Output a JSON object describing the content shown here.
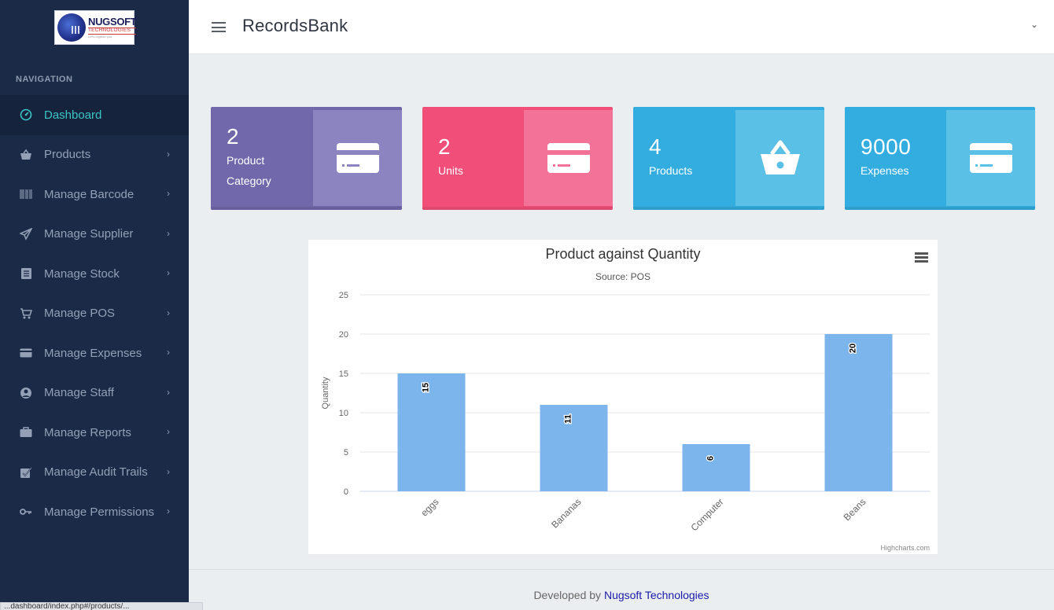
{
  "logo": {
    "line1": "NUGSOFT",
    "line2": "TECHNOLOGIES",
    "line3": "Let's Digitize you"
  },
  "nav": {
    "heading": "NAVIGATION",
    "items": [
      {
        "label": "Dashboard",
        "icon": "dashboard-icon",
        "active": true
      },
      {
        "label": "Products",
        "icon": "basket-icon"
      },
      {
        "label": "Manage Barcode",
        "icon": "barcode-icon"
      },
      {
        "label": "Manage Supplier",
        "icon": "paper-plane-icon"
      },
      {
        "label": "Manage Stock",
        "icon": "list-icon"
      },
      {
        "label": "Manage POS",
        "icon": "cart-icon"
      },
      {
        "label": "Manage Expenses",
        "icon": "credit-card-icon"
      },
      {
        "label": "Manage Staff",
        "icon": "user-circle-icon"
      },
      {
        "label": "Manage Reports",
        "icon": "briefcase-icon"
      },
      {
        "label": "Manage Audit Trails",
        "icon": "check-square-icon"
      },
      {
        "label": "Manage Permissions",
        "icon": "key-icon"
      }
    ]
  },
  "header": {
    "title": "RecordsBank"
  },
  "cards": [
    {
      "value": "2",
      "label": "Product\nCategory",
      "color": "#7167ab",
      "pane": "#8c84c0",
      "icon": "credit-card-icon"
    },
    {
      "value": "2",
      "label": "Units",
      "color": "#f14f7a",
      "pane": "#f37297",
      "icon": "credit-card-icon"
    },
    {
      "value": "4",
      "label": "Products",
      "color": "#33ade0",
      "pane": "#5bc0e6",
      "icon": "basket-icon"
    },
    {
      "value": "9000",
      "label": "Expenses",
      "color": "#33ade0",
      "pane": "#5bc0e6",
      "icon": "credit-card-icon"
    }
  ],
  "chart_data": {
    "type": "bar",
    "title": "Product against Quantity",
    "subtitle": "Source: POS",
    "ylabel": "Quantity",
    "xlabel": "",
    "categories": [
      "eggs",
      "Bananas",
      "Computer",
      "Beans"
    ],
    "values": [
      15,
      11,
      6,
      20
    ],
    "ylim": [
      0,
      25
    ],
    "yticks": [
      0,
      5,
      10,
      15,
      20,
      25
    ],
    "grid": true,
    "bar_color": "#7cb5ec",
    "credits": "Highcharts.com"
  },
  "footer": {
    "prefix": "Developed by",
    "link": "Nugsoft Technologies"
  },
  "status": {
    "url": "...dashboard/index.php#/products/..."
  }
}
